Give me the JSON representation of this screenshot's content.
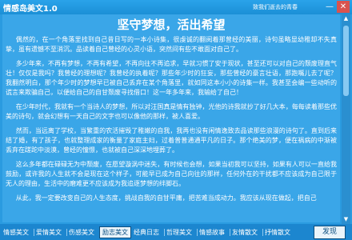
{
  "window": {
    "title": "情感岛美文1.0",
    "subtitle": "致我们逝去的青春",
    "minimize_glyph": "—",
    "close_glyph": "✕"
  },
  "article": {
    "title": "坚守梦想，活出希望",
    "paragraphs": [
      "偶然的，在一个角落里找到自己昔日写的一本小诗集，很虔诚的翻阅着那曾经的美丽，诗句虽略显幼稚却不失真挚，虽有遗憾不至消沉。品读着自己曾经的心灵小语，突然间有些不敢面对自己了。",
      "多少年来，不再有梦想，不再有希望，不再向往不再追求，早就习惯了安于现状，甚至还可以对自己的颓废理直气壮！仅仅是我吗？我曾经的理想呢？我曾经的执着呢？那些年少时的狂妄，那些曾经的豪言壮语，那跑嘴儿去了呢？我翻然明白，那个年少时的梦想早已被自己丢弃在某个角落里，就如同这本小小的诗集一样。我甚至会编一些动听的谎言来欺骗自己，以便给自己的自甘颓废寻找借口！这一年多年来，我输给了自己！",
      "在少年时代，我就有一个当诗人的梦想，所以对汪国真是情有独钟，光他的诗我就抄了好几大本，每每读着那些优美的诗句，就会幻想有一天自己的文字也可以像他的那样，被人喜爱。",
      "然而，当远离了学校，当繁重的农活摧毁了稚嫩的自我，我再也没有闲情逸致去品读那些浪漫的诗句了。直到后来结了婚，有了孩子，也就整理成家的衡量了家庭主妇，过着普普通通平凡的日子。那个绝美的梦，便在祸病的中渐被丢弃在蹉跎中淡漠，曾经的憧憬，也就被自己深深地埋葬了。",
      "这么多年都在碌碌无为中颓废，在愿望漩涡中迷失，有时候也会想，如果当初我可以坚持，如果有人可以一直给我鼓励，或许我的人生就不会是现在这个样子，可能早已成为自己向往的那样，任何外在的干扰都不应该成为自己限于无人的理由，生活中的磨难更不应该成为我追逐梦想的绊脚石。",
      "从此，我一定要改变自己的人生态度，挑战自我的自甘平庸，把苦难当成动力。我应该从现在做起，把自己"
    ]
  },
  "bottom_nav": {
    "tabs": [
      "情感美文",
      "爱情美文",
      "伤感美文",
      "励志美文",
      "经典日志",
      "哲理美文",
      "情感故事",
      "友情散文",
      "抒情散文",
      "心情随笔"
    ],
    "active_index": 3,
    "find_button": "发现"
  },
  "scrollbar": {
    "up_glyph": "▲",
    "down_glyph": "▼"
  },
  "colors": {
    "accent": "#2a9be0",
    "active_tab_bg": "#e9f4fb"
  }
}
